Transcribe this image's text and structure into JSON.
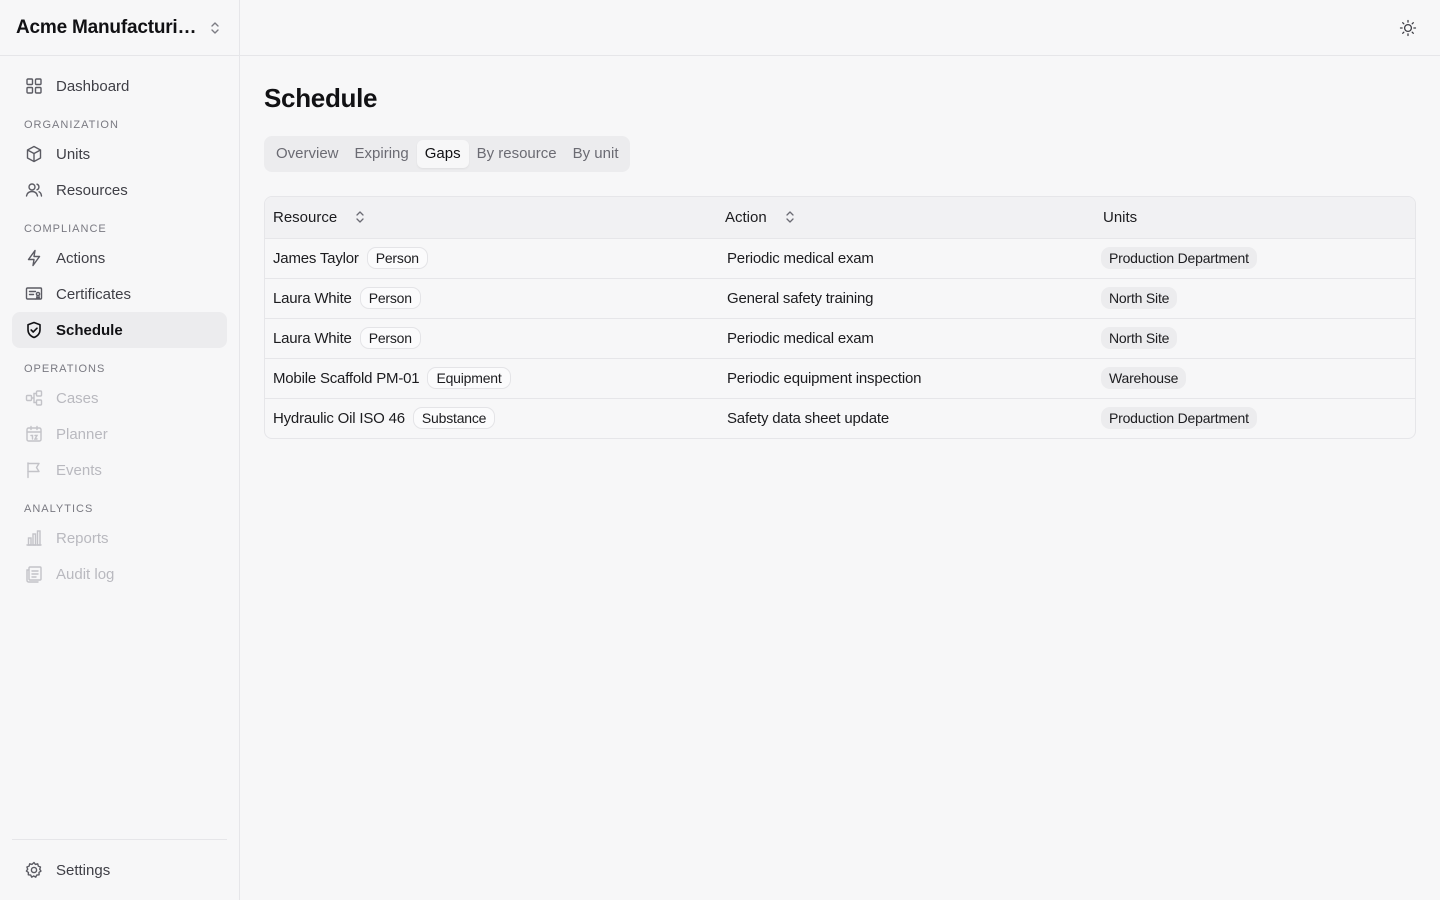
{
  "org": {
    "name": "Acme Manufacturin..."
  },
  "nav": {
    "dashboard": "Dashboard",
    "sections": {
      "organization": "ORGANIZATION",
      "compliance": "COMPLIANCE",
      "operations": "OPERATIONS",
      "analytics": "ANALYTICS"
    },
    "units": "Units",
    "resources": "Resources",
    "actions": "Actions",
    "certificates": "Certificates",
    "schedule": "Schedule",
    "cases": "Cases",
    "planner": "Planner",
    "events": "Events",
    "reports": "Reports",
    "audit_log": "Audit log",
    "settings": "Settings"
  },
  "page": {
    "title": "Schedule"
  },
  "tabs": [
    "Overview",
    "Expiring",
    "Gaps",
    "By resource",
    "By unit"
  ],
  "active_tab": "Gaps",
  "table": {
    "headers": {
      "resource": "Resource",
      "action": "Action",
      "units": "Units"
    },
    "rows": [
      {
        "resource": "James Taylor",
        "type": "Person",
        "action": "Periodic medical exam",
        "unit": "Production Department"
      },
      {
        "resource": "Laura White",
        "type": "Person",
        "action": "General safety training",
        "unit": "North Site"
      },
      {
        "resource": "Laura White",
        "type": "Person",
        "action": "Periodic medical exam",
        "unit": "North Site"
      },
      {
        "resource": "Mobile Scaffold PM-01",
        "type": "Equipment",
        "action": "Periodic equipment inspection",
        "unit": "Warehouse"
      },
      {
        "resource": "Hydraulic Oil ISO 46",
        "type": "Substance",
        "action": "Safety data sheet update",
        "unit": "Production Department"
      }
    ]
  },
  "colors": {
    "background": "#f7f7f8",
    "border": "#e6e6e9",
    "active_nav": "#ececee",
    "text": "#1c1c1f",
    "muted": "#6b6b73",
    "disabled": "#b9b9bf"
  },
  "icons": {
    "org_switcher": "chevrons-up-down-icon",
    "theme_toggle": "sun-icon",
    "dashboard": "grid-icon",
    "units": "cube-icon",
    "resources": "users-icon",
    "actions": "lightning-icon",
    "certificates": "certificate-icon",
    "schedule": "shield-check-icon",
    "cases": "workflow-icon",
    "planner": "calendar-icon",
    "events": "flag-icon",
    "reports": "bar-chart-icon",
    "audit_log": "receipt-icon",
    "settings": "gear-icon"
  }
}
